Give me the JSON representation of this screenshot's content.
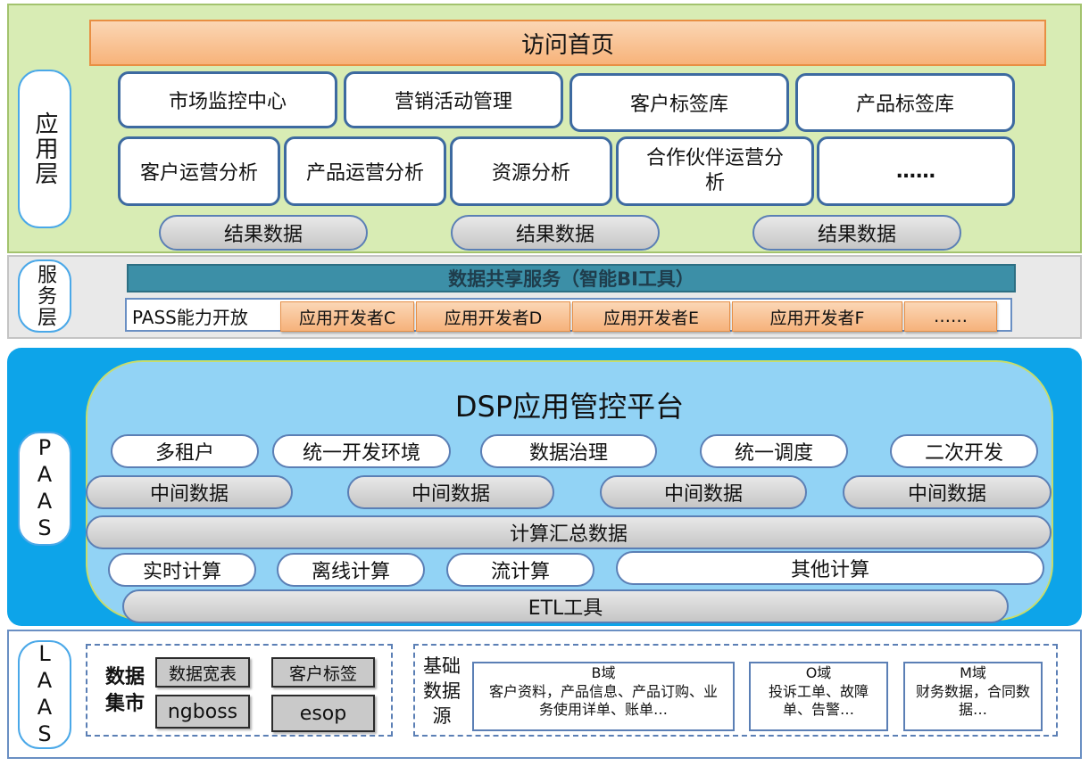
{
  "app_layer": {
    "label": "应用层",
    "home": "访问首页",
    "row1": [
      "市场监控中心",
      "营销活动管理",
      "客户标签库",
      "产品标签库"
    ],
    "row2": [
      "客户运营分析",
      "产品运营分析",
      "资源分析",
      "合作伙伴运营分析",
      "……"
    ],
    "result_data": [
      "结果数据",
      "结果数据",
      "结果数据"
    ]
  },
  "service_layer": {
    "label": "服务层",
    "share_service": "数据共享服务（智能BI工具）",
    "pass_label": "PASS能力开放",
    "developers": [
      "应用开发者C",
      "应用开发者D",
      "应用开发者E",
      "应用开发者F",
      "……"
    ]
  },
  "paas_layer": {
    "label": "PAAS",
    "title": "DSP应用管控平台",
    "capabilities": [
      "多租户",
      "统一开发环境",
      "数据治理",
      "统一调度",
      "二次开发"
    ],
    "middle_data": [
      "中间数据",
      "中间数据",
      "中间数据",
      "中间数据"
    ],
    "summary_data": "计算汇总数据",
    "computing": [
      "实时计算",
      "离线计算",
      "流计算",
      "其他计算"
    ],
    "etl": "ETL工具"
  },
  "laas_layer": {
    "label": "LAAS",
    "data_mart": {
      "title": "数据集市",
      "items": [
        "数据宽表",
        "客户标签",
        "ngboss",
        "esop"
      ]
    },
    "base_source": {
      "title": "基础数据源",
      "domains": [
        {
          "name": "B域",
          "desc": "客户资料，产品信息、产品订购、业务使用详单、账单…"
        },
        {
          "name": "O域",
          "desc": "投诉工单、故障单、告警…"
        },
        {
          "name": "M域",
          "desc": "财务数据，合同数据…"
        }
      ]
    }
  }
}
